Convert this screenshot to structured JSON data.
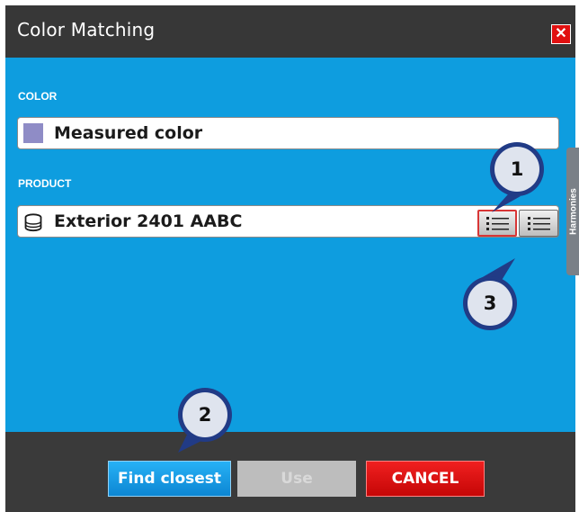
{
  "window": {
    "title": "Color Matching",
    "close_symbol": "✕"
  },
  "color_section": {
    "label": "COLOR",
    "value": "Measured color",
    "swatch_color": "#8f8cc6"
  },
  "product_section": {
    "label": "PRODUCT",
    "value": "Exterior 2401 AABC",
    "product_icon": "paint-can-icon",
    "list_buttons": [
      {
        "icon": "list-view-icon",
        "selected": true
      },
      {
        "icon": "list-view-icon",
        "selected": false
      }
    ]
  },
  "side_tab": {
    "label": "Harmonies"
  },
  "callouts": [
    "1",
    "2",
    "3"
  ],
  "buttons": {
    "find_closest": "Find closest",
    "use": "Use",
    "cancel": "CANCEL"
  },
  "colors": {
    "title_bar": "#373737",
    "content_bg": "#0e9ddf",
    "bottom_bar": "#3a3a3a",
    "accent_blue": "#1aa1e8",
    "cancel_red": "#dd1111",
    "disabled_gray": "#bdbdbd"
  }
}
